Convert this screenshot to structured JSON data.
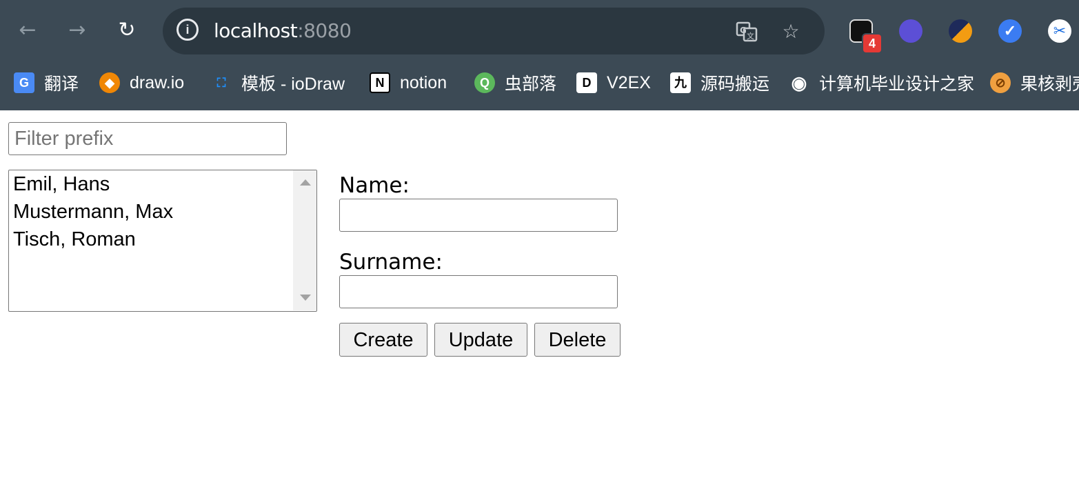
{
  "browser": {
    "nav": {
      "back_icon": "←",
      "forward_icon": "→",
      "reload_icon": "↻"
    },
    "url": {
      "host": "localhost",
      "port": ":8080"
    },
    "extensions": [
      {
        "name": "extension-notify",
        "badge": "4",
        "color": "#111111"
      },
      {
        "name": "extension-s-purple",
        "color": "#5c4fd6"
      },
      {
        "name": "extension-s-orange",
        "color": "#f39c12"
      },
      {
        "name": "extension-check",
        "color": "#3b7cf2"
      },
      {
        "name": "extension-scissors",
        "color": "#ffffff"
      }
    ],
    "bookmarks": [
      {
        "label": "翻译",
        "icon": "translate-icon",
        "glyph": "G",
        "color": "#4a8af4"
      },
      {
        "label": "draw.io",
        "icon": "drawio-icon",
        "glyph": "◆",
        "color": "#f08705"
      },
      {
        "label": "模板 - ioDraw",
        "icon": "iodraw-icon",
        "glyph": "⛶",
        "color": "#1e90ff"
      },
      {
        "label": "notion",
        "icon": "notion-icon",
        "glyph": "N",
        "color": "#ffffff"
      },
      {
        "label": "虫部落",
        "icon": "chongbuluo-icon",
        "glyph": "Q",
        "color": "#5cb85c"
      },
      {
        "label": "V2EX",
        "icon": "v2ex-icon",
        "glyph": "D",
        "color": "#ffffff"
      },
      {
        "label": "源码搬运",
        "icon": "yuanma-icon",
        "glyph": "九",
        "color": "#ffffff"
      },
      {
        "label": "计算机毕业设计之家",
        "icon": "globe-icon",
        "glyph": "◉",
        "color": "#ffffff"
      },
      {
        "label": "果核剥壳",
        "icon": "guohe-icon",
        "glyph": "⊘",
        "color": "#f0a040"
      }
    ]
  },
  "app": {
    "filter_placeholder": "Filter prefix",
    "filter_value": "",
    "people": [
      "Emil, Hans",
      "Mustermann, Max",
      "Tisch, Roman"
    ],
    "name_label": "Name:",
    "name_value": "",
    "surname_label": "Surname:",
    "surname_value": "",
    "buttons": {
      "create": "Create",
      "update": "Update",
      "delete": "Delete"
    }
  }
}
